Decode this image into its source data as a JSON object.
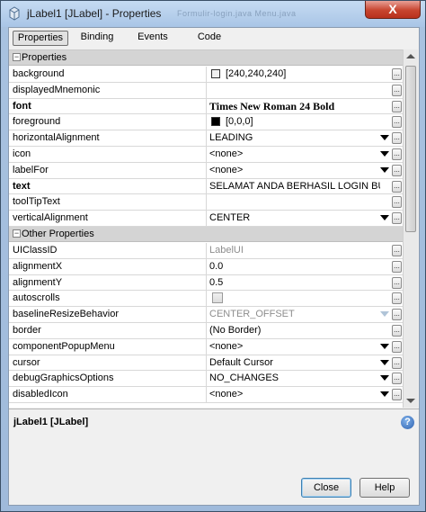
{
  "window": {
    "title": "jLabel1 [JLabel] - Properties",
    "background_tabs": "Formulir-login.java    Menu.java",
    "close_glyph": "X"
  },
  "tabs": [
    {
      "label": "Properties",
      "active": true
    },
    {
      "label": "Binding",
      "active": false
    },
    {
      "label": "Events",
      "active": false
    },
    {
      "label": "Code",
      "active": false
    }
  ],
  "categories": {
    "properties": {
      "label": "Properties",
      "toggle": "−"
    },
    "other": {
      "label": "Other Properties",
      "toggle": "−"
    }
  },
  "properties": [
    {
      "name": "background",
      "value": "[240,240,240]",
      "swatch": "#f0f0f0"
    },
    {
      "name": "displayedMnemonic",
      "value": ""
    },
    {
      "name": "font",
      "value": "Times New Roman 24 Bold",
      "bold": true
    },
    {
      "name": "foreground",
      "value": "[0,0,0]",
      "swatch": "#000000"
    },
    {
      "name": "horizontalAlignment",
      "value": "LEADING",
      "dropdown": true
    },
    {
      "name": "icon",
      "value": "<none>",
      "dropdown": true
    },
    {
      "name": "labelFor",
      "value": "<none>",
      "dropdown": true
    },
    {
      "name": "text",
      "value": "SELAMAT ANDA BERHASIL LOGIN BUNG!!",
      "bold": true
    },
    {
      "name": "toolTipText",
      "value": ""
    },
    {
      "name": "verticalAlignment",
      "value": "CENTER",
      "dropdown": true
    }
  ],
  "other_properties": [
    {
      "name": "UIClassID",
      "value": "LabelUI",
      "grey": true
    },
    {
      "name": "alignmentX",
      "value": "0.0"
    },
    {
      "name": "alignmentY",
      "value": "0.5"
    },
    {
      "name": "autoscrolls",
      "value": "",
      "checkbox": false
    },
    {
      "name": "baselineResizeBehavior",
      "value": "CENTER_OFFSET",
      "grey": true,
      "dropdown": true
    },
    {
      "name": "border",
      "value": "(No Border)"
    },
    {
      "name": "componentPopupMenu",
      "value": "<none>",
      "dropdown": true
    },
    {
      "name": "cursor",
      "value": "Default Cursor",
      "dropdown": true
    },
    {
      "name": "debugGraphicsOptions",
      "value": "NO_CHANGES",
      "dropdown": true
    },
    {
      "name": "disabledIcon",
      "value": "<none>",
      "dropdown": true
    }
  ],
  "ellipsis": "...",
  "description": {
    "title": "jLabel1 [JLabel]",
    "help_glyph": "?"
  },
  "buttons": {
    "close": "Close",
    "help": "Help"
  }
}
